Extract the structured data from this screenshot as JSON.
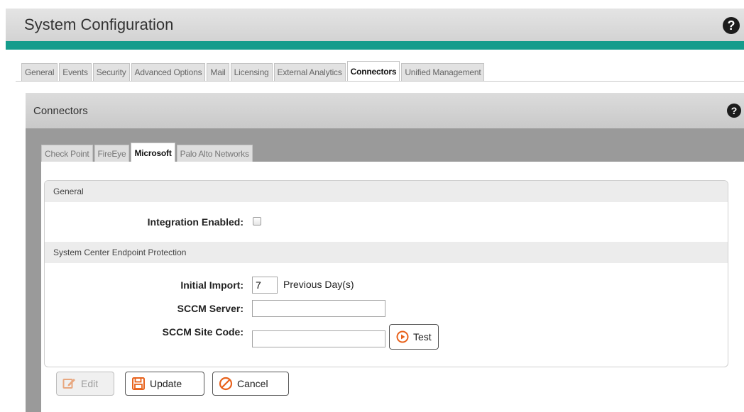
{
  "window": {
    "title": "System Configuration",
    "help_glyph": "?"
  },
  "main_tabs": [
    {
      "label": "General"
    },
    {
      "label": "Events"
    },
    {
      "label": "Security"
    },
    {
      "label": "Advanced Options"
    },
    {
      "label": "Mail"
    },
    {
      "label": "Licensing"
    },
    {
      "label": "External Analytics"
    },
    {
      "label": "Connectors",
      "active": true
    },
    {
      "label": "Unified Management"
    }
  ],
  "connectors_panel": {
    "title": "Connectors",
    "help_glyph": "?"
  },
  "connector_tabs": [
    {
      "label": "Check Point"
    },
    {
      "label": "FireEye"
    },
    {
      "label": "Microsoft",
      "active": true
    },
    {
      "label": "Palo Alto Networks"
    }
  ],
  "general_section": {
    "heading": "General",
    "integration_label": "Integration Enabled:",
    "integration_checked": false
  },
  "scep_section": {
    "heading": "System Center Endpoint Protection",
    "initial_import_label": "Initial Import:",
    "initial_import_value": "7",
    "initial_import_unit": "Previous Day(s)",
    "sccm_server_label": "SCCM Server:",
    "sccm_server_value": "",
    "sccm_site_code_label": "SCCM Site Code:",
    "sccm_site_code_value": "",
    "test_button": "Test"
  },
  "actions": {
    "edit": "Edit",
    "update": "Update",
    "cancel": "Cancel"
  },
  "colors": {
    "accent": "#159c8c",
    "icon_orange": "#e8621c",
    "disabled_icon": "#e8a77f"
  },
  "icons": {
    "help": "help-icon",
    "play": "play-circle-icon",
    "edit": "pencil-icon",
    "update": "save-icon",
    "cancel": "cancel-icon"
  }
}
